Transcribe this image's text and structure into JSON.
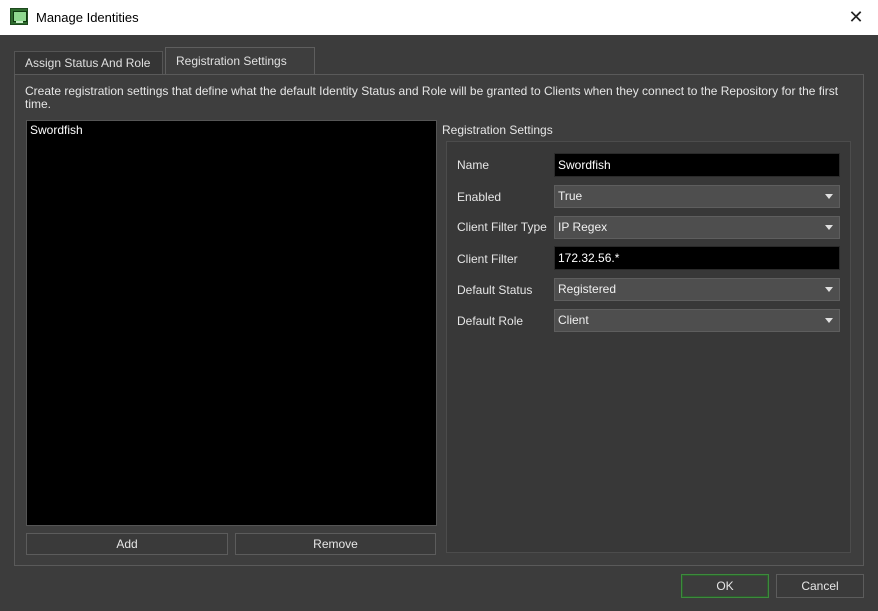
{
  "window": {
    "title": "Manage Identities",
    "icon": "monitor-app-icon",
    "close_glyph": "✕"
  },
  "tabs": [
    {
      "label": "Assign Status And Role",
      "active": false
    },
    {
      "label": "Registration Settings",
      "active": true
    }
  ],
  "description": "Create registration settings that define what the default Identity Status and Role will be granted to Clients when they connect to the Repository for the first time.",
  "list": {
    "items": [
      "Swordfish"
    ]
  },
  "buttons": {
    "add": "Add",
    "remove": "Remove",
    "ok": "OK",
    "cancel": "Cancel"
  },
  "registration": {
    "title": "Registration Settings",
    "fields": {
      "name": {
        "label": "Name",
        "value": "Swordfish"
      },
      "enabled": {
        "label": "Enabled",
        "value": "True"
      },
      "client_filter_type": {
        "label": "Client Filter Type",
        "value": "IP Regex"
      },
      "client_filter": {
        "label": "Client Filter",
        "value": "172.32.56.*"
      },
      "default_status": {
        "label": "Default Status",
        "value": "Registered"
      },
      "default_role": {
        "label": "Default Role",
        "value": "Client"
      }
    }
  },
  "colors": {
    "background": "#3c3c3c",
    "input_bg": "#000000",
    "ok_border": "#3d8a3d"
  }
}
